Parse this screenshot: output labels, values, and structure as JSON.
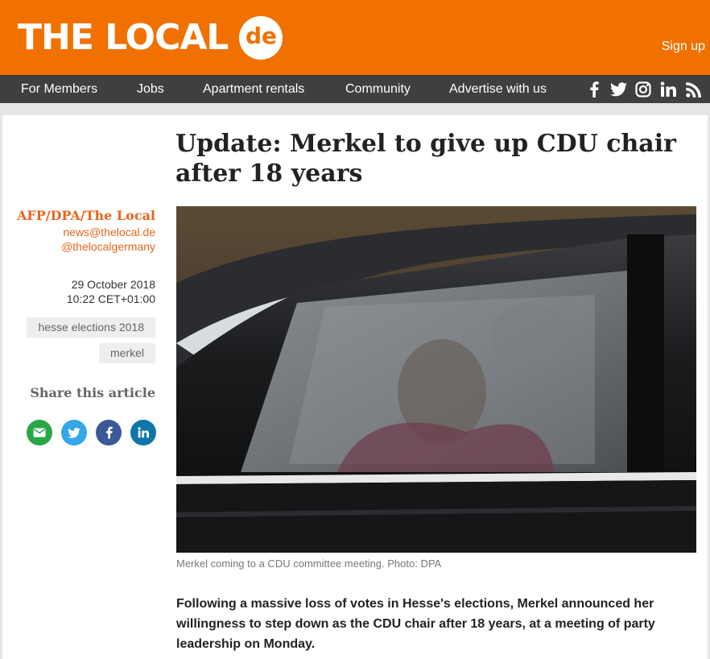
{
  "header": {
    "logo_text": "THE LOCAL",
    "logo_badge": "de",
    "signup_label": "Sign up",
    "brand_color": "#f07100"
  },
  "nav": {
    "items": [
      "For Members",
      "Jobs",
      "Apartment rentals",
      "Community",
      "Advertise with us"
    ],
    "social_icons": [
      "facebook-icon",
      "twitter-icon",
      "instagram-icon",
      "linkedin-icon",
      "rss-icon"
    ]
  },
  "article": {
    "headline": "Update: Merkel to give up CDU chair after 18 years",
    "author": "AFP/DPA/The Local",
    "email": "news@thelocal.de",
    "twitter_handle": "@thelocalgermany",
    "date": "29 October 2018",
    "time": "10:22 CET+01:00",
    "tags": [
      "hesse elections 2018",
      "merkel"
    ],
    "share_title": "Share this article",
    "share_buttons": [
      "email-icon",
      "twitter-icon",
      "facebook-icon",
      "linkedin-icon"
    ],
    "photo_caption": "Merkel coming to a CDU committee meeting. Photo: DPA",
    "lead": "Following a massive loss of votes in Hesse's elections, Merkel announced her willingness to step down as the CDU chair after 18 years, at a meeting of party leadership on Monday."
  }
}
